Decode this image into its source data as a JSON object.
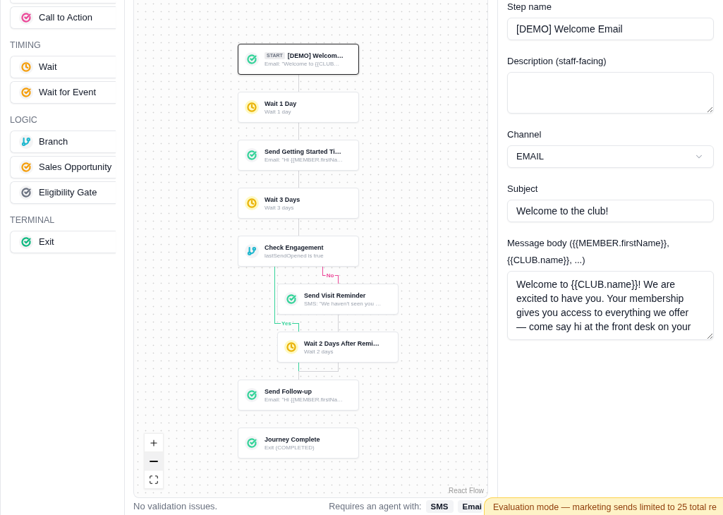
{
  "palette": {
    "partial_top_item": true,
    "groups": [
      {
        "items": [
          {
            "label": "Call to Action",
            "kind": "check",
            "color": "#ec4899"
          }
        ]
      },
      {
        "title": "TIMING",
        "items": [
          {
            "label": "Wait",
            "kind": "clock",
            "color": "#f59e0b"
          },
          {
            "label": "Wait for Event",
            "kind": "check",
            "color": "#f59e0b"
          }
        ]
      },
      {
        "title": "LOGIC",
        "items": [
          {
            "label": "Branch",
            "kind": "branch",
            "color": "#22b8cf"
          },
          {
            "label": "Sales Opportunity",
            "kind": "check",
            "color": "#f59e0b"
          },
          {
            "label": "Eligibility Gate",
            "kind": "check",
            "color": "#6b7280"
          }
        ]
      },
      {
        "title": "TERMINAL",
        "items": [
          {
            "label": "Exit",
            "kind": "check",
            "color": "#10b981"
          }
        ]
      }
    ]
  },
  "canvas": {
    "nodes": [
      {
        "badge": "START",
        "title": "[DEMO] Welcom…",
        "subtitle": "Email: \"Welcome to {{CLUB…",
        "kind": "check",
        "color": "#34d399",
        "selected": true
      },
      {
        "title": "Wait 1 Day",
        "subtitle": "Wait 1 day",
        "kind": "clock",
        "color": "#eab308",
        "selected": false
      },
      {
        "title": "Send Getting Started Ti…",
        "subtitle": "Email: \"Hi {{MEMBER.firstNa…",
        "kind": "check",
        "color": "#34d399",
        "selected": false
      },
      {
        "title": "Wait 3 Days",
        "subtitle": "Wait 3 days",
        "kind": "clock",
        "color": "#eab308",
        "selected": false
      },
      {
        "title": "Check Engagement",
        "subtitle": "lastSendOpened is true",
        "kind": "branch",
        "color": "#22b8cf",
        "selected": false
      },
      {
        "title": "Send Visit Reminder",
        "subtitle": "SMS: \"We haven't seen you …",
        "kind": "check",
        "color": "#34d399",
        "selected": false
      },
      {
        "title": "Wait 2 Days After Remi…",
        "subtitle": "Wait 2 days",
        "kind": "clock",
        "color": "#eab308",
        "selected": false
      },
      {
        "title": "Send Follow-up",
        "subtitle": "Email: \"Hi {{MEMBER.firstNa…",
        "kind": "check",
        "color": "#34d399",
        "selected": false
      },
      {
        "title": "Journey Complete",
        "subtitle": "Exit (COMPLETED)",
        "kind": "check",
        "color": "#34d399",
        "selected": false
      }
    ],
    "edges": [
      {
        "kind": "next",
        "color": "#d4d4d8"
      },
      {
        "kind": "next",
        "color": "#d4d4d8"
      },
      {
        "kind": "next",
        "color": "#d4d4d8"
      },
      {
        "kind": "next",
        "color": "#d4d4d8"
      },
      {
        "kind": "no",
        "label": "No",
        "color": "#ec4899"
      },
      {
        "kind": "yes",
        "label": "Yes",
        "color": "#34d399"
      },
      {
        "kind": "next",
        "color": "#d4d4d8"
      },
      {
        "kind": "next",
        "color": "#d4d4d8"
      }
    ],
    "controls": [
      {
        "kind": "zoom_in",
        "highlighted": false
      },
      {
        "kind": "zoom_out",
        "highlighted": true
      },
      {
        "kind": "fit_view",
        "highlighted": false
      }
    ],
    "attribution": "React Flow"
  },
  "footer": {
    "validation": "No validation issues.",
    "requirements_label": "Requires an agent with:",
    "channels": [
      "SMS",
      "Emai"
    ]
  },
  "form": {
    "fields": [
      {
        "label": "Step name",
        "kind": "text",
        "value": "[DEMO] Welcome Email"
      },
      {
        "label": "Description (staff-facing)",
        "kind": "textarea"
      },
      {
        "label": "Channel",
        "kind": "select",
        "value": "EMAIL"
      },
      {
        "label": "Subject",
        "kind": "text",
        "value": "Welcome to the club!"
      },
      {
        "label": "Message body ({{MEMBER.firstName}}, {{CLUB.name}}, ...)",
        "kind": "message",
        "value": "Welcome to {{CLUB.name}}! We are excited to have you. Your membership gives you access to everything we offer — come say hi at the front desk on your"
      }
    ]
  },
  "toast": {
    "text": "Evaluation mode — marketing sends limited to 25 total re"
  }
}
